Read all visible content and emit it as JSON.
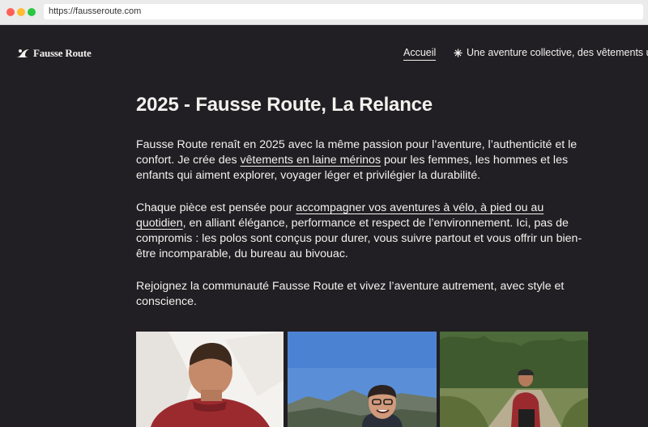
{
  "browser": {
    "url": "https://fausseroute.com"
  },
  "header": {
    "logo_text": "Fausse Route",
    "nav_home": "Accueil",
    "marquee_text": "Une aventure collective, des vêtements uniques"
  },
  "main": {
    "title": "2025 - Fausse Route, La Relance",
    "p1_before": "Fausse Route renaît en 2025 avec la même passion pour l’aventure, l’authenticité et le confort. Je crée des ",
    "p1_link": "vêtements en laine mérinos",
    "p1_after": " pour les femmes, les hommes et les enfants qui aiment explorer, voyager léger et privilégier la durabilité.",
    "p2_before": "Chaque pièce est pensée pour ",
    "p2_link": "accompagner vos aventures à vélo, à pied ou au quotidien",
    "p2_after": ", en alliant élégance, performance et respect de l’environnement. Ici, pas de compromis : les polos sont conçus pour durer, vous suivre partout et vous offrir un bien-être incomparable, du bureau au bivouac.",
    "p3": "Rejoignez la communauté Fausse Route et vivez l’aventure autrement, avec style et conscience."
  },
  "colors": {
    "background": "#211f23",
    "text": "#f3f1ee",
    "shirt": "#9b2a2e"
  },
  "gallery": {
    "photos": [
      "man-back-red-polo",
      "smiling-man-glasses-mountains",
      "cyclist-forest-path"
    ]
  }
}
